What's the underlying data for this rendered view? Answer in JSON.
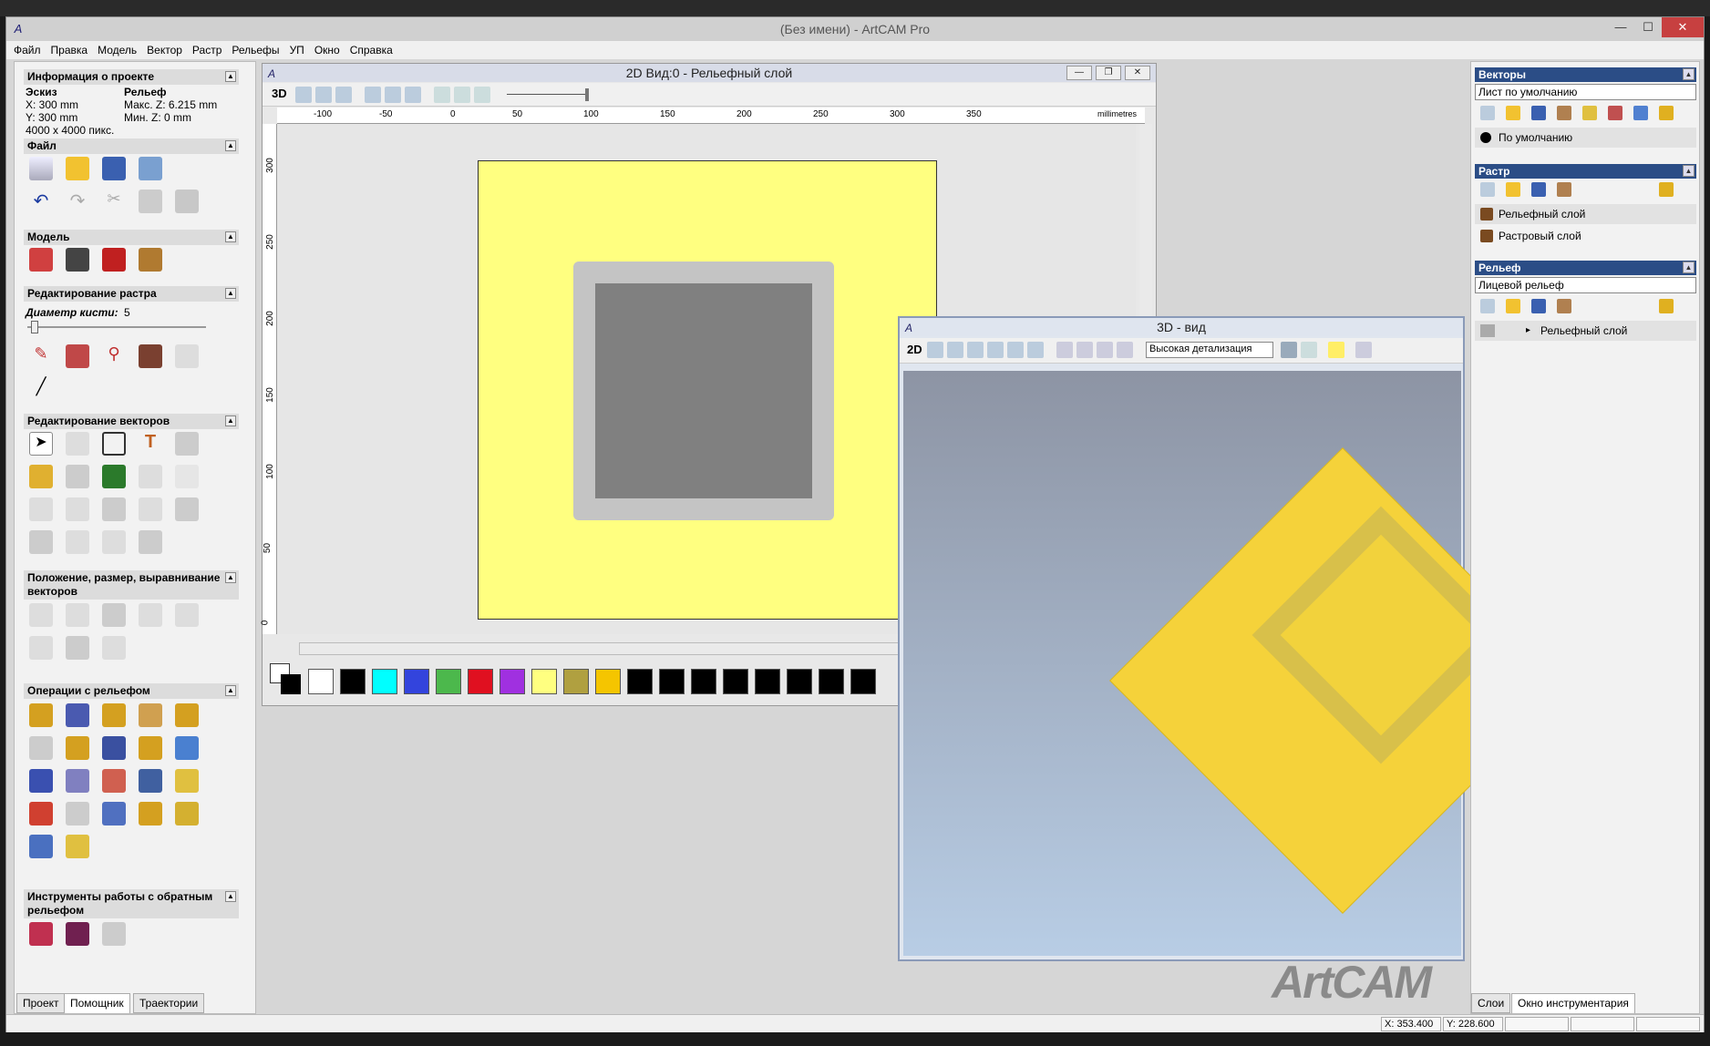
{
  "window": {
    "title": "(Без имени) - ArtCAM Pro",
    "logo": "A",
    "minimize": "—",
    "maximize": "☐",
    "close": "✕"
  },
  "menu": [
    "Файл",
    "Правка",
    "Модель",
    "Вектор",
    "Растр",
    "Рельефы",
    "УП",
    "Окно",
    "Справка"
  ],
  "left": {
    "project_info": {
      "title": "Информация о проекте",
      "sketch_label": "Эскиз",
      "x": "X: 300 mm",
      "y": "Y: 300 mm",
      "pixels": "4000 x 4000 пикс.",
      "relief_label": "Рельеф",
      "max_z": "Макс. Z: 6.215 mm",
      "min_z": "Мин. Z: 0 mm"
    },
    "file": "Файл",
    "model": "Модель",
    "raster_edit": "Редактирование растра",
    "brush_label": "Диаметр кисти:",
    "brush_value": "5",
    "vector_edit": "Редактирование векторов",
    "position": "Положение, размер, выравнивание векторов",
    "relief_ops": "Операции с рельефом",
    "reverse": "Инструменты работы с обратным рельефом",
    "tabs": [
      "Проект",
      "Помощник",
      "Траектории"
    ]
  },
  "view2d": {
    "title": "2D Вид:0 - Рельефный слой",
    "btn3d": "3D",
    "units": "millimetres",
    "hticks": [
      "-100",
      "-50",
      "0",
      "50",
      "100",
      "150",
      "200",
      "250",
      "300",
      "350"
    ],
    "vticks": [
      "300",
      "250",
      "200",
      "150",
      "100",
      "50",
      "0"
    ]
  },
  "palette": [
    "#ffffff",
    "#000000",
    "#00ffff",
    "#3344dd",
    "#4cb84c",
    "#e01020",
    "#a030e0",
    "#ffff80",
    "#b0a040",
    "#f5c500",
    "#000000",
    "#000000",
    "#000000",
    "#000000",
    "#000000",
    "#000000",
    "#000000",
    "#000000"
  ],
  "view3d": {
    "title": "3D - вид",
    "btn2d": "2D",
    "detail": "Высокая детализация"
  },
  "right": {
    "vectors": {
      "title": "Векторы",
      "sheet": "Лист по умолчанию",
      "layer": "По умолчанию"
    },
    "raster": {
      "title": "Растр",
      "layers": [
        "Рельефный слой",
        "Растровый слой"
      ]
    },
    "relief": {
      "title": "Рельеф",
      "sheet": "Лицевой рельеф",
      "layer": "Рельефный слой"
    },
    "tabs": [
      "Слои",
      "Окно инструментария"
    ]
  },
  "status": {
    "x": "X: 353.400",
    "y": "Y: 228.600"
  },
  "watermark": "ArtCAM"
}
